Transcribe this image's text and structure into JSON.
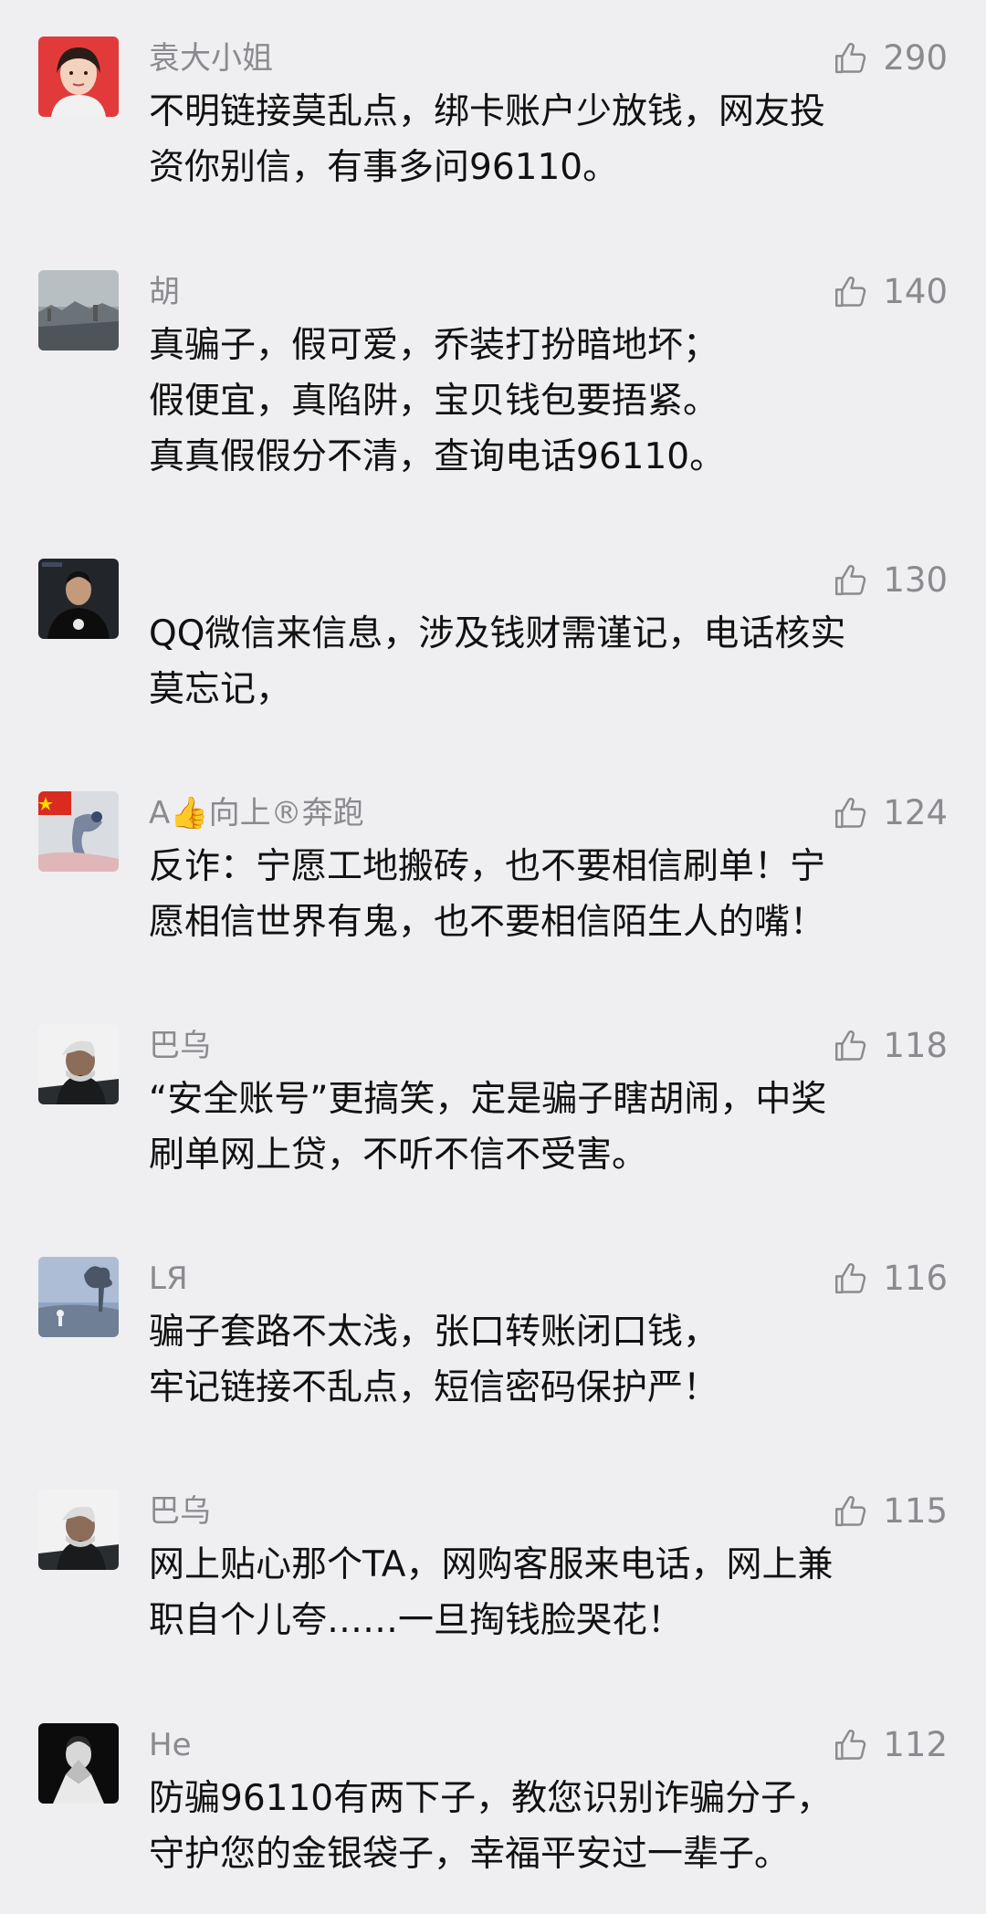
{
  "comments": [
    {
      "username": "袁大小姐",
      "likes": "290",
      "lines": [
        "不明链接莫乱点，绑卡账户少放钱，网友投",
        "资你别信，有事多问96110。"
      ]
    },
    {
      "username": "胡",
      "likes": "140",
      "lines": [
        "真骗子，假可爱，乔装打扮暗地坏；",
        "假便宜，真陷阱，宝贝钱包要捂紧。",
        "真真假假分不清，查询电话96110。"
      ]
    },
    {
      "username": "",
      "likes": "130",
      "lines": [
        "QQ微信来信息，涉及钱财需谨记，电话核实",
        "莫忘记，"
      ]
    },
    {
      "username": "A👍向上®奔跑",
      "likes": "124",
      "lines": [
        "反诈：宁愿工地搬砖，也不要相信刷单！宁",
        "愿相信世界有鬼，也不要相信陌生人的嘴！"
      ]
    },
    {
      "username": "巴乌",
      "likes": "118",
      "lines": [
        "“安全账号”更搞笑，定是骗子瞎胡闹，中奖",
        "刷单网上贷，不听不信不受害。"
      ]
    },
    {
      "username": "LЯ",
      "likes": "116",
      "lines": [
        "骗子套路不太浅，张口转账闭口钱，",
        "牢记链接不乱点，短信密码保护严！"
      ]
    },
    {
      "username": "巴乌",
      "likes": "115",
      "lines": [
        "网上贴心那个TA，网购客服来电话，网上兼",
        "职自个儿夸……一旦掏钱脸哭花！"
      ]
    },
    {
      "username": "He",
      "likes": "112",
      "lines": [
        "防骗96110有两下子，教您识别诈骗分子，",
        "守护您的金银袋子，幸福平安过一辈子。"
      ]
    }
  ]
}
